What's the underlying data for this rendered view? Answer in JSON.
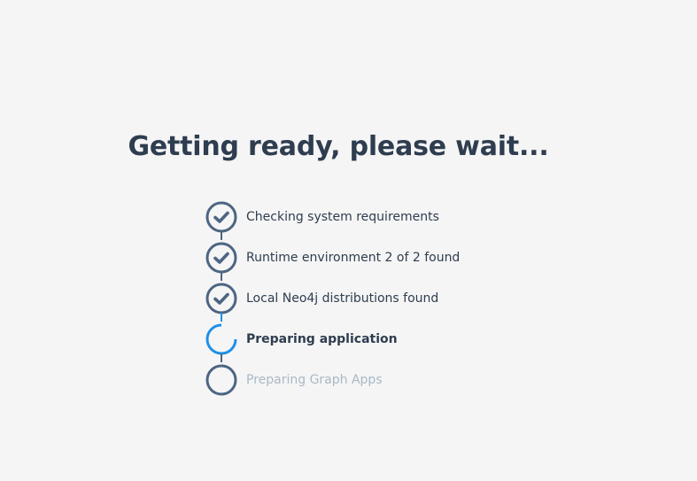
{
  "title": "Getting ready, please wait...",
  "steps": [
    {
      "label": "Checking system requirements",
      "status": "done",
      "icon": "check-icon"
    },
    {
      "label": "Runtime environment 2 of 2 found",
      "status": "done",
      "icon": "check-icon"
    },
    {
      "label": "Local Neo4j distributions found",
      "status": "done",
      "icon": "check-icon"
    },
    {
      "label": "Preparing application",
      "status": "in-progress",
      "icon": "spinner-icon"
    },
    {
      "label": "Preparing Graph Apps",
      "status": "pending",
      "icon": "empty-circle-icon"
    }
  ],
  "colors": {
    "background": "#f5f5f5",
    "text": "#2e3d4f",
    "done": "#4d6582",
    "active": "#1e90e8",
    "pending_text": "#a9b8c8"
  }
}
